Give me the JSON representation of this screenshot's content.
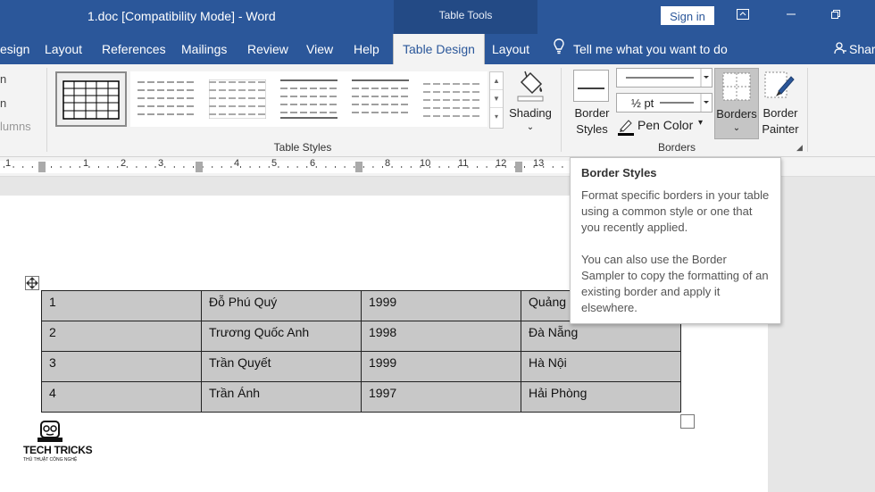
{
  "titlebar": {
    "doc_title": "1.doc [Compatibility Mode]  -  Word",
    "context_tab": "Table Tools",
    "signin_label": "Sign in",
    "ribbon_display_icon": "ribbon-display-icon",
    "minimize_icon": "minimize-icon",
    "restore_icon": "restore-icon"
  },
  "tabs": [
    {
      "label": "esign"
    },
    {
      "label": "Layout"
    },
    {
      "label": "References"
    },
    {
      "label": "Mailings"
    },
    {
      "label": "Review"
    },
    {
      "label": "View"
    },
    {
      "label": "Help"
    },
    {
      "label": "Table Design"
    },
    {
      "label": "Layout"
    }
  ],
  "tellme": {
    "label": "Tell me what you want to do",
    "icon": "lightbulb-icon"
  },
  "share": {
    "label": "Shar"
  },
  "ribbon": {
    "left_partial": [
      "n",
      "n",
      "lumns"
    ],
    "table_styles_label": "Table Styles",
    "shading_label": "Shading",
    "borders_group_label": "Borders",
    "border_styles_label1": "Border",
    "border_styles_label2": "Styles",
    "pen_weight": "½ pt",
    "pen_color_label": "Pen Color",
    "borders_label": "Borders",
    "border_painter_label1": "Border",
    "border_painter_label2": "Painter",
    "dropdown_arrow": "⌄",
    "pen_color": "#000000"
  },
  "ruler": {
    "numbers": [
      "1",
      "1",
      "2",
      "3",
      "4",
      "5",
      "6",
      "7",
      "8",
      "9",
      "10",
      "11",
      "12",
      "13"
    ]
  },
  "tooltip": {
    "title": "Border Styles",
    "para1": "Format specific borders in your table using a common style or one that you recently applied.",
    "para2": "You can also use the Border Sampler to copy the formatting of an existing border and apply it elsewhere."
  },
  "table": {
    "rows": [
      [
        "1",
        " Đỗ Phú Quý",
        " 1999",
        " Quảng"
      ],
      [
        "2",
        " Trương Quốc Anh",
        " 1998",
        " Đà Nẵng"
      ],
      [
        "3",
        "Trần Quyết",
        "1999",
        "Hà Nội"
      ],
      [
        "4",
        "Trần Ánh",
        "1997",
        "Hải Phòng"
      ]
    ]
  },
  "watermark": {
    "line1": "TECH TRICKS",
    "line2": "THỦ THUẬT CÔNG NGHỆ"
  },
  "colors": {
    "titlebar": "#2b579a",
    "cell_fill": "#c8c8c8",
    "ribbon": "#f3f3f3"
  }
}
